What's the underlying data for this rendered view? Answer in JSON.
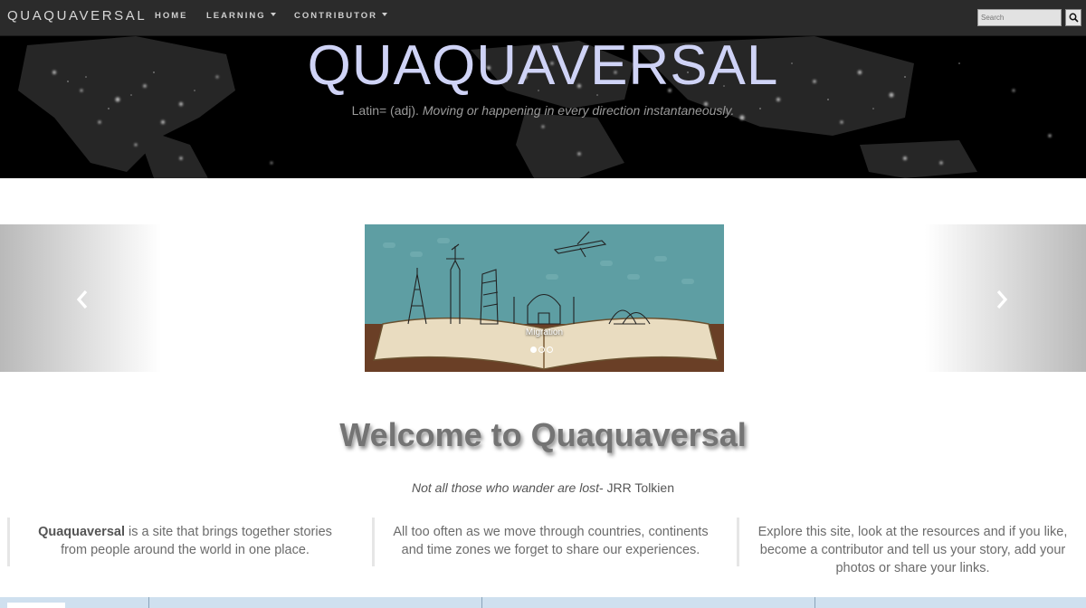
{
  "navbar": {
    "brand": "QUAQUAVERSAL",
    "items": [
      {
        "label": "HOME",
        "dropdown": false
      },
      {
        "label": "LEARNING",
        "dropdown": true
      },
      {
        "label": "CONTRIBUTOR",
        "dropdown": true
      }
    ],
    "search": {
      "placeholder": "Search",
      "button_icon": "search-icon"
    }
  },
  "hero": {
    "title": "QUAQUAVERSAL",
    "subtitle_prefix": "Latin= (adj).",
    "subtitle_italic": "Moving or happening in every direction instantaneously."
  },
  "carousel": {
    "caption": "Migration",
    "slide_count": 3,
    "active_index": 0,
    "prev_icon": "chevron-left-icon",
    "next_icon": "chevron-right-icon"
  },
  "welcome": {
    "heading": "Welcome to Quaquaversal",
    "quote_italic": "Not all those who wander are lost",
    "quote_author": "- JRR Tolkien"
  },
  "columns": [
    {
      "bold": "Quaquaversal",
      "line1_rest": " is a site that brings together stories",
      "line2": "from people around the world in one place."
    },
    {
      "line1": "All too often as we move through countries, continents",
      "line2": "and time zones we forget to share our experiences."
    },
    {
      "line1": "Explore this site, look at the resources and if you like,",
      "line2": "become a contributor and tell us your story, add your",
      "line3": "photos or share your links."
    }
  ],
  "colors": {
    "navbar_bg": "#2b2b2b",
    "hero_title": "#cfd3f6",
    "heading_text": "#747474",
    "slide_teal": "#5e9ea3"
  }
}
